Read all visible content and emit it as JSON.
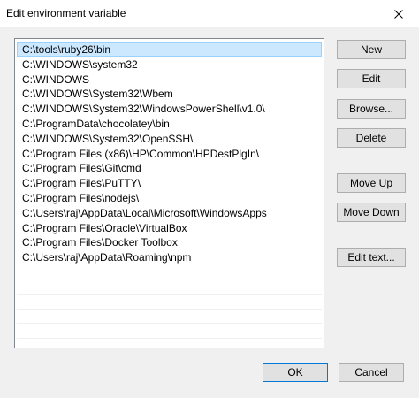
{
  "window": {
    "title": "Edit environment variable"
  },
  "path_list": {
    "items": [
      "C:\\tools\\ruby26\\bin",
      "C:\\WINDOWS\\system32",
      "C:\\WINDOWS",
      "C:\\WINDOWS\\System32\\Wbem",
      "C:\\WINDOWS\\System32\\WindowsPowerShell\\v1.0\\",
      "C:\\ProgramData\\chocolatey\\bin",
      "C:\\WINDOWS\\System32\\OpenSSH\\",
      "C:\\Program Files (x86)\\HP\\Common\\HPDestPlgIn\\",
      "C:\\Program Files\\Git\\cmd",
      "C:\\Program Files\\PuTTY\\",
      "C:\\Program Files\\nodejs\\",
      "C:\\Users\\raj\\AppData\\Local\\Microsoft\\WindowsApps",
      "C:\\Program Files\\Oracle\\VirtualBox",
      "C:\\Program Files\\Docker Toolbox",
      "C:\\Users\\raj\\AppData\\Roaming\\npm"
    ],
    "selected_index": 0
  },
  "buttons": {
    "new": "New",
    "edit": "Edit",
    "browse": "Browse...",
    "delete": "Delete",
    "move_up": "Move Up",
    "move_down": "Move Down",
    "edit_text": "Edit text...",
    "ok": "OK",
    "cancel": "Cancel"
  },
  "colors": {
    "selection": "#cce8ff",
    "selection_border": "#99d1ff",
    "button_face": "#e1e1e1",
    "default_button_border": "#0078d7"
  }
}
